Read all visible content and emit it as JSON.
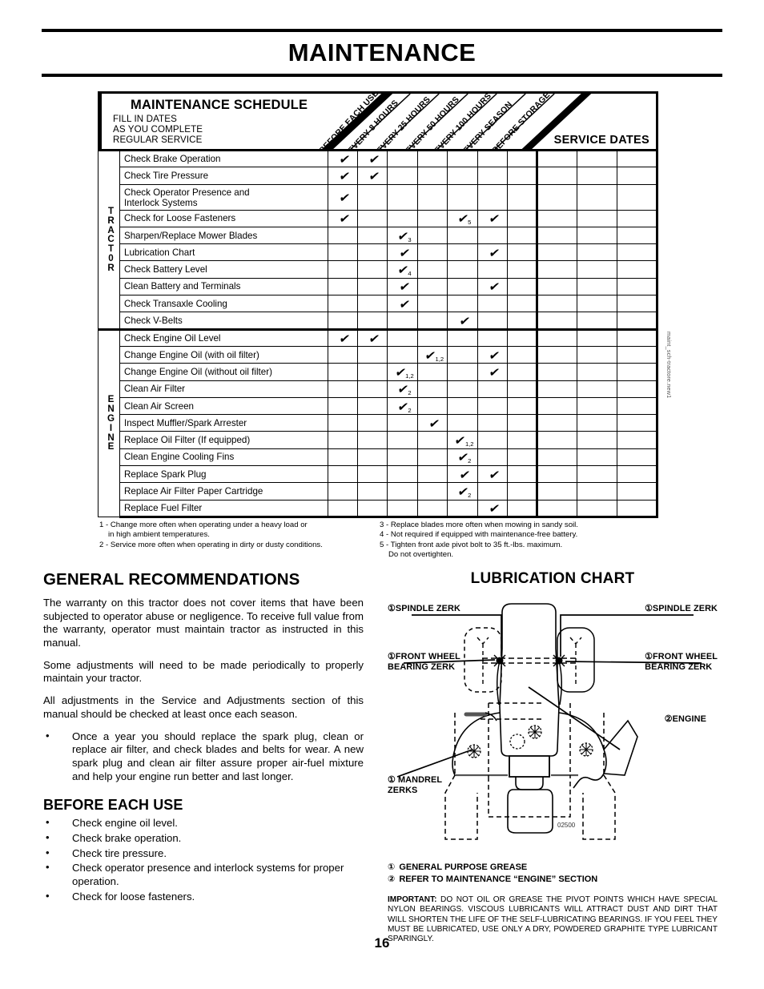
{
  "page": {
    "title": "MAINTENANCE",
    "number": "16"
  },
  "schedule": {
    "title": "MAINTENANCE SCHEDULE",
    "subtitle_lines": [
      "FILL IN DATES",
      "AS YOU COMPLETE",
      "REGULAR SERVICE"
    ],
    "interval_columns": [
      "BEFORE EACH USE",
      "EVERY 8 HOURS",
      "EVERY 25 HOURS",
      "EVERY 50 HOURS",
      "EVERY 100 HOURS",
      "EVERY SEASON",
      "BEFORE STORAGE"
    ],
    "service_dates_label": "SERVICE DATES",
    "service_date_columns": 3,
    "check_glyph": "✔",
    "side_caption": "maint_sch-tractore.new1",
    "sections": [
      {
        "name": "TRACT0R",
        "rows": [
          {
            "task": "Check Brake Operation",
            "marks": [
              {
                "col": 0
              },
              {
                "col": 1
              }
            ]
          },
          {
            "task": "Check Tire Pressure",
            "marks": [
              {
                "col": 0
              },
              {
                "col": 1
              }
            ]
          },
          {
            "task": "Check Operator Presence and\nInterlock Systems",
            "two_line": true,
            "marks": [
              {
                "col": 0
              }
            ]
          },
          {
            "task": "Check for Loose Fasteners",
            "marks": [
              {
                "col": 0
              },
              {
                "col": 4,
                "note": "5"
              },
              {
                "col": 5
              }
            ]
          },
          {
            "task": "Sharpen/Replace Mower Blades",
            "marks": [
              {
                "col": 2,
                "note": "3"
              }
            ]
          },
          {
            "task": "Lubrication Chart",
            "marks": [
              {
                "col": 2
              },
              {
                "col": 5
              }
            ]
          },
          {
            "task": "Check Battery Level",
            "marks": [
              {
                "col": 2,
                "note": "4"
              }
            ]
          },
          {
            "task": "Clean Battery and Terminals",
            "marks": [
              {
                "col": 2
              },
              {
                "col": 5
              }
            ]
          },
          {
            "task": "Check Transaxle Cooling",
            "marks": [
              {
                "col": 2
              }
            ]
          },
          {
            "task": "Check V-Belts",
            "marks": [
              {
                "col": 4
              }
            ]
          }
        ]
      },
      {
        "name": "ENGINE",
        "rows": [
          {
            "task": "Check Engine Oil Level",
            "marks": [
              {
                "col": 0
              },
              {
                "col": 1
              }
            ]
          },
          {
            "task": "Change Engine Oil (with oil filter)",
            "marks": [
              {
                "col": 3,
                "note": "1,2"
              },
              {
                "col": 5
              }
            ]
          },
          {
            "task": "Change Engine Oil (without oil filter)",
            "marks": [
              {
                "col": 2,
                "note": "1,2"
              },
              {
                "col": 5
              }
            ]
          },
          {
            "task": "Clean Air Filter",
            "marks": [
              {
                "col": 2,
                "note": "2"
              }
            ]
          },
          {
            "task": "Clean Air Screen",
            "marks": [
              {
                "col": 2,
                "note": "2"
              }
            ]
          },
          {
            "task": "Inspect Muffler/Spark Arrester",
            "marks": [
              {
                "col": 3
              }
            ]
          },
          {
            "task": "Replace Oil Filter (If equipped)",
            "marks": [
              {
                "col": 4,
                "note": "1,2"
              }
            ]
          },
          {
            "task": "Clean Engine Cooling Fins",
            "marks": [
              {
                "col": 4,
                "note": "2"
              }
            ]
          },
          {
            "task": "Replace Spark Plug",
            "marks": [
              {
                "col": 4
              },
              {
                "col": 5
              }
            ]
          },
          {
            "task": "Replace Air Filter Paper Cartridge",
            "marks": [
              {
                "col": 4,
                "note": "2"
              }
            ]
          },
          {
            "task": "Replace Fuel Filter",
            "marks": [
              {
                "col": 5
              }
            ]
          }
        ]
      }
    ],
    "footnotes_left": [
      {
        "num": "1 -",
        "text": "Change more often when operating under a heavy load or",
        "cont": "in high ambient temperatures."
      },
      {
        "num": "2 -",
        "text": "Service more often when operating in dirty or dusty conditions.",
        "cont": ""
      }
    ],
    "footnotes_right": [
      {
        "num": "3 -",
        "text": "Replace blades more often when mowing in sandy soil.",
        "cont": ""
      },
      {
        "num": "4 -",
        "text": "Not required if equipped with maintenance-free battery.",
        "cont": ""
      },
      {
        "num": "5 -",
        "text": "Tighten front axle pivot bolt to 35 ft.-lbs. maximum.",
        "cont": "Do not overtighten."
      }
    ]
  },
  "general": {
    "heading": "GENERAL RECOMMENDATIONS",
    "paragraphs": [
      "The warranty on this tractor does not cover items that have been subjected to operator abuse or negligence. To receive full value from the warranty, operator must maintain tractor as instructed in this manual.",
      "Some adjustments will need to be made periodically to properly maintain your tractor.",
      "All adjustments in the Service and Adjustments section of this manual should be checked at least once each season."
    ],
    "bullets": [
      "Once a year you should replace the spark plug, clean or replace air filter, and check blades and belts for wear. A new spark plug and clean air filter assure proper air-fuel mixture and help your engine run better and last longer."
    ]
  },
  "before_each_use": {
    "heading": "BEFORE EACH USE",
    "bullets": [
      "Check engine oil level.",
      "Check brake operation.",
      "Check tire pressure.",
      "Check operator presence and interlock systems for proper operation.",
      "Check for loose fasteners."
    ]
  },
  "lubrication": {
    "title": "LUBRICATION CHART",
    "labels": {
      "spindle_left": "①SPINDLE ZERK",
      "spindle_right": "①SPINDLE ZERK",
      "front_wheel_left": "①FRONT WHEEL\nBEARING  ZERK",
      "front_wheel_right": "①FRONT WHEEL\nBEARING  ZERK",
      "engine": "②ENGINE",
      "mandrel": "① MANDREL\nZERKS"
    },
    "part_number": "02500",
    "legend": [
      {
        "sym": "①",
        "text": "GENERAL PURPOSE GREASE"
      },
      {
        "sym": "②",
        "text": "REFER TO MAINTENANCE “ENGINE” SECTION"
      }
    ],
    "important_label": "IMPORTANT:",
    "important_text": "DO NOT OIL OR GREASE THE PIVOT POINTS WHICH HAVE SPECIAL NYLON BEARINGS.  VISCOUS LUBRICANTS WILL ATTRACT DUST AND DIRT THAT WILL SHORTEN THE LIFE OF THE SELF-LUBRICATING BEARINGS.  IF YOU FEEL THEY MUST BE LUBRICATED, USE ONLY A DRY, POWDERED GRAPHITE TYPE LUBRICANT SPARINGLY."
  }
}
